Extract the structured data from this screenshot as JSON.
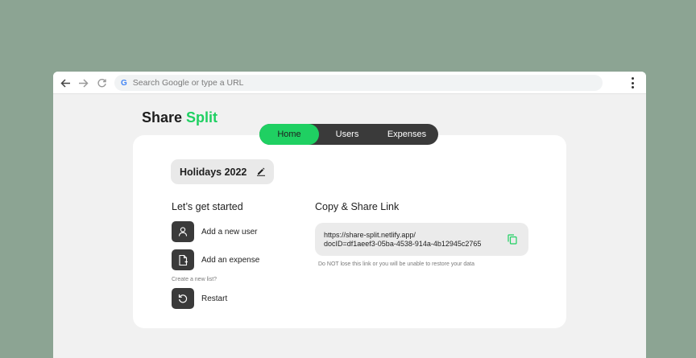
{
  "browser": {
    "omnibox_placeholder": "Search Google or type a URL",
    "google_glyph": "G",
    "icons": [
      "back-arrow-icon",
      "forward-arrow-icon",
      "reload-icon",
      "google-icon",
      "more-vert-icon"
    ]
  },
  "app": {
    "brand_main": "Share",
    "brand_accent": "Split",
    "accent_color": "#1fd062",
    "dark_color": "#3a3a3a"
  },
  "nav": {
    "tabs": [
      {
        "label": "Home",
        "active": true
      },
      {
        "label": "Users",
        "active": false
      },
      {
        "label": "Expenses",
        "active": false
      }
    ]
  },
  "list": {
    "name": "Holidays 2022",
    "edit_icon": "pencil-icon"
  },
  "getting_started": {
    "title": "Let’s get started",
    "actions": [
      {
        "label": "Add a new user",
        "icon": "user-icon"
      },
      {
        "label": "Add an expense",
        "icon": "add-file-icon"
      },
      {
        "label": "Restart",
        "icon": "restart-icon"
      }
    ],
    "new_list_hint": "Create a new list?"
  },
  "share": {
    "title": "Copy & Share Link",
    "link_line1": "https://share-split.netlify.app/",
    "link_line2": "docID=df1aeef3-05ba-4538-914a-4b12945c2765",
    "copy_icon": "copy-icon",
    "warning": "Do NOT lose this link or you will be unable to restore your data"
  }
}
